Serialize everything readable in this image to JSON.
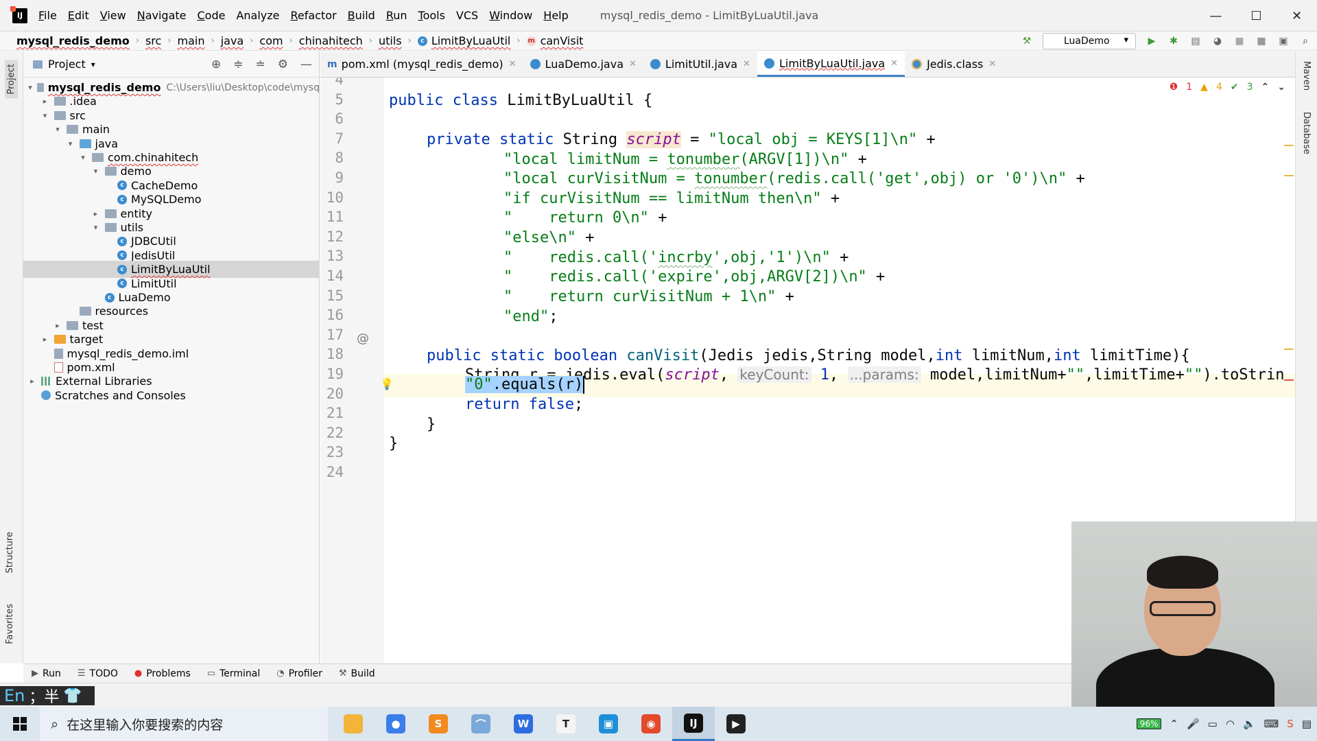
{
  "window": {
    "title": "mysql_redis_demo - LimitByLuaUtil.java",
    "menu": [
      {
        "label": "File",
        "mn": "F",
        "rest": "ile"
      },
      {
        "label": "Edit",
        "mn": "E",
        "rest": "dit"
      },
      {
        "label": "View",
        "mn": "V",
        "rest": "iew"
      },
      {
        "label": "Navigate",
        "mn": "N",
        "rest": "avigate"
      },
      {
        "label": "Code",
        "mn": "C",
        "rest": "ode"
      },
      {
        "label": "Analyze",
        "mn": "",
        "rest": "Analyze"
      },
      {
        "label": "Refactor",
        "mn": "R",
        "rest": "efactor"
      },
      {
        "label": "Build",
        "mn": "B",
        "rest": "uild"
      },
      {
        "label": "Run",
        "mn": "R",
        "rest": "un"
      },
      {
        "label": "Tools",
        "mn": "T",
        "rest": "ools"
      },
      {
        "label": "VCS",
        "mn": "",
        "rest": "VCS"
      },
      {
        "label": "Window",
        "mn": "W",
        "rest": "indow"
      },
      {
        "label": "Help",
        "mn": "H",
        "rest": "elp"
      }
    ],
    "controls": {
      "minimize": "—",
      "maximize": "☐",
      "close": "✕"
    }
  },
  "breadcrumbs": [
    "mysql_redis_demo",
    "src",
    "main",
    "java",
    "com",
    "chinahitech",
    "utils",
    "LimitByLuaUtil",
    "canVisit"
  ],
  "toolbar": {
    "run_config": "LuaDemo"
  },
  "side_tabs": {
    "project": "Project",
    "structure": "Structure",
    "favorites": "Favorites",
    "maven": "Maven",
    "database": "Database"
  },
  "project_panel": {
    "title": "Project",
    "tree": [
      {
        "label": "mysql_redis_demo",
        "hint": "C:\\Users\\liu\\Desktop\\code\\mysq",
        "depth": 0,
        "arrow": "▾",
        "icon": "folder",
        "bold": true
      },
      {
        "label": ".idea",
        "depth": 1,
        "arrow": "▸",
        "icon": "folder"
      },
      {
        "label": "src",
        "depth": 1,
        "arrow": "▾",
        "icon": "folder"
      },
      {
        "label": "main",
        "depth": 2,
        "arrow": "▾",
        "icon": "folder"
      },
      {
        "label": "java",
        "depth": 3,
        "arrow": "▾",
        "icon": "folder-blue"
      },
      {
        "label": "com.chinahitech",
        "depth": 4,
        "arrow": "▾",
        "icon": "folder"
      },
      {
        "label": "demo",
        "depth": 5,
        "arrow": "▾",
        "icon": "folder"
      },
      {
        "label": "CacheDemo",
        "depth": 6,
        "arrow": "",
        "icon": "class"
      },
      {
        "label": "MySQLDemo",
        "depth": 6,
        "arrow": "",
        "icon": "class"
      },
      {
        "label": "entity",
        "depth": 5,
        "arrow": "▸",
        "icon": "folder"
      },
      {
        "label": "utils",
        "depth": 5,
        "arrow": "▾",
        "icon": "folder"
      },
      {
        "label": "JDBCUtil",
        "depth": 6,
        "arrow": "",
        "icon": "class"
      },
      {
        "label": "JedisUtil",
        "depth": 6,
        "arrow": "",
        "icon": "class"
      },
      {
        "label": "LimitByLuaUtil",
        "depth": 6,
        "arrow": "",
        "icon": "class",
        "selected": true
      },
      {
        "label": "LimitUtil",
        "depth": 6,
        "arrow": "",
        "icon": "class"
      },
      {
        "label": "LuaDemo",
        "depth": 5,
        "arrow": "",
        "icon": "class"
      },
      {
        "label": "resources",
        "depth": 3,
        "arrow": "",
        "icon": "folder"
      },
      {
        "label": "test",
        "depth": 2,
        "arrow": "▸",
        "icon": "folder"
      },
      {
        "label": "target",
        "depth": 1,
        "arrow": "▸",
        "icon": "folder-orange"
      },
      {
        "label": "mysql_redis_demo.iml",
        "depth": 1,
        "arrow": "",
        "icon": "iml"
      },
      {
        "label": "pom.xml",
        "depth": 1,
        "arrow": "",
        "icon": "xml"
      },
      {
        "label": "External Libraries",
        "depth": 0,
        "arrow": "▸",
        "icon": "lib"
      },
      {
        "label": "Scratches and Consoles",
        "depth": 0,
        "arrow": "",
        "icon": "scratch"
      }
    ]
  },
  "editor_tabs": [
    {
      "label": "pom.xml (mysql_redis_demo)",
      "icon": "m"
    },
    {
      "label": "LuaDemo.java",
      "icon": "class"
    },
    {
      "label": "LimitUtil.java",
      "icon": "class"
    },
    {
      "label": "LimitByLuaUtil.java",
      "icon": "class",
      "active": true
    },
    {
      "label": "Jedis.class",
      "icon": "class-ro"
    }
  ],
  "inspections": {
    "errors": "1",
    "warnings": "4",
    "weak": "3"
  },
  "editor": {
    "line_numbers": [
      "4",
      "5",
      "6",
      "7",
      "8",
      "9",
      "10",
      "11",
      "12",
      "13",
      "14",
      "15",
      "16",
      "17",
      "18",
      "19",
      "20",
      "21",
      "22",
      "23",
      "24"
    ],
    "lines": {
      "l5": {
        "kw1": "public class",
        "name": " LimitByLuaUtil {"
      },
      "l7": {
        "kw": "private static",
        "type": " String ",
        "field": "script",
        "eq": " = ",
        "str": "\"local obj = KEYS[1]\\n\"",
        "plus": " +"
      },
      "l8": {
        "pre": "\"local limitNum = ",
        "fn": "tonumber",
        "post": "(ARGV[1])\\n\"",
        "plus": " +"
      },
      "l9": {
        "pre": "\"local curVisitNum = ",
        "fn": "tonumber",
        "post": "(redis.call('get',obj) or '0')\\n\"",
        "plus": " +"
      },
      "l10": {
        "pre": "\"if curVisitNum == ",
        "fn": "limitNum",
        "post": " then\\n\"",
        "plus": " +"
      },
      "l11": {
        "str": "\"    return 0\\n\"",
        "plus": " +"
      },
      "l12": {
        "str": "\"else\\n\"",
        "plus": " +"
      },
      "l13": {
        "pre": "\"    redis.call('",
        "fn": "incrby",
        "post": "',obj,'1')\\n\"",
        "plus": " +"
      },
      "l14": {
        "str": "\"    redis.call('expire',obj,ARGV[2])\\n\"",
        "plus": " +"
      },
      "l15": {
        "str": "\"    return curVisitNum + 1\\n\"",
        "plus": " +"
      },
      "l16": {
        "str": "\"end\"",
        "semi": ";"
      },
      "l18": {
        "kw": "public static boolean",
        "meth": " canVisit",
        "p1": "(Jedis jedis,String model,",
        "kw2": "int",
        "p2": " limitNum,",
        "kw3": "int",
        "p3": " limitTime){"
      },
      "l19": {
        "pre": "String r = jedis.eval(",
        "field": "script",
        "comma": ", ",
        "hint1": "keyCount:",
        "num": " 1",
        "comma2": ", ",
        "hint2": "...params:",
        "post": " model,limitNum+",
        "s1": "\"\"",
        "mid": ",limitTime+",
        "s2": "\"\"",
        "end": ").toStrin"
      },
      "l20": {
        "str": "\"0\"",
        "rest": ".equals(r)"
      },
      "l21": {
        "kw": "return false",
        "semi": ";"
      },
      "l22": {
        "brace": "}"
      },
      "l23": {
        "brace": "}"
      }
    }
  },
  "bottom_tools": [
    {
      "label": "Run",
      "icon": "▶"
    },
    {
      "label": "TODO",
      "icon": "☰"
    },
    {
      "label": "Problems",
      "icon": "●"
    },
    {
      "label": "Terminal",
      "icon": "▭"
    },
    {
      "label": "Profiler",
      "icon": "◔"
    },
    {
      "label": "Build",
      "icon": "⚒"
    }
  ],
  "ime": {
    "lang": "En",
    "rest": "；半"
  },
  "taskbar": {
    "search_placeholder": "在这里输入你要搜索的内容",
    "battery": "96%",
    "apps": [
      {
        "name": "file-explorer",
        "color": "#f2b53a",
        "glyph": ""
      },
      {
        "name": "chrome",
        "color": "#3b7de9",
        "glyph": "●"
      },
      {
        "name": "sublime",
        "color": "#f28a1e",
        "glyph": "S"
      },
      {
        "name": "feather",
        "color": "#7aa8d8",
        "glyph": "⌒"
      },
      {
        "name": "wps-writer",
        "color": "#2d6de0",
        "glyph": "W"
      },
      {
        "name": "typora",
        "color": "#f4f4f4",
        "glyph": "T"
      },
      {
        "name": "screen-tool",
        "color": "#1f8fd8",
        "glyph": "▣"
      },
      {
        "name": "swirl-app",
        "color": "#e24a2b",
        "glyph": "◉"
      },
      {
        "name": "intellij",
        "color": "#111111",
        "glyph": "IJ",
        "active": true
      },
      {
        "name": "recorder",
        "color": "#222222",
        "glyph": "▶"
      }
    ]
  }
}
